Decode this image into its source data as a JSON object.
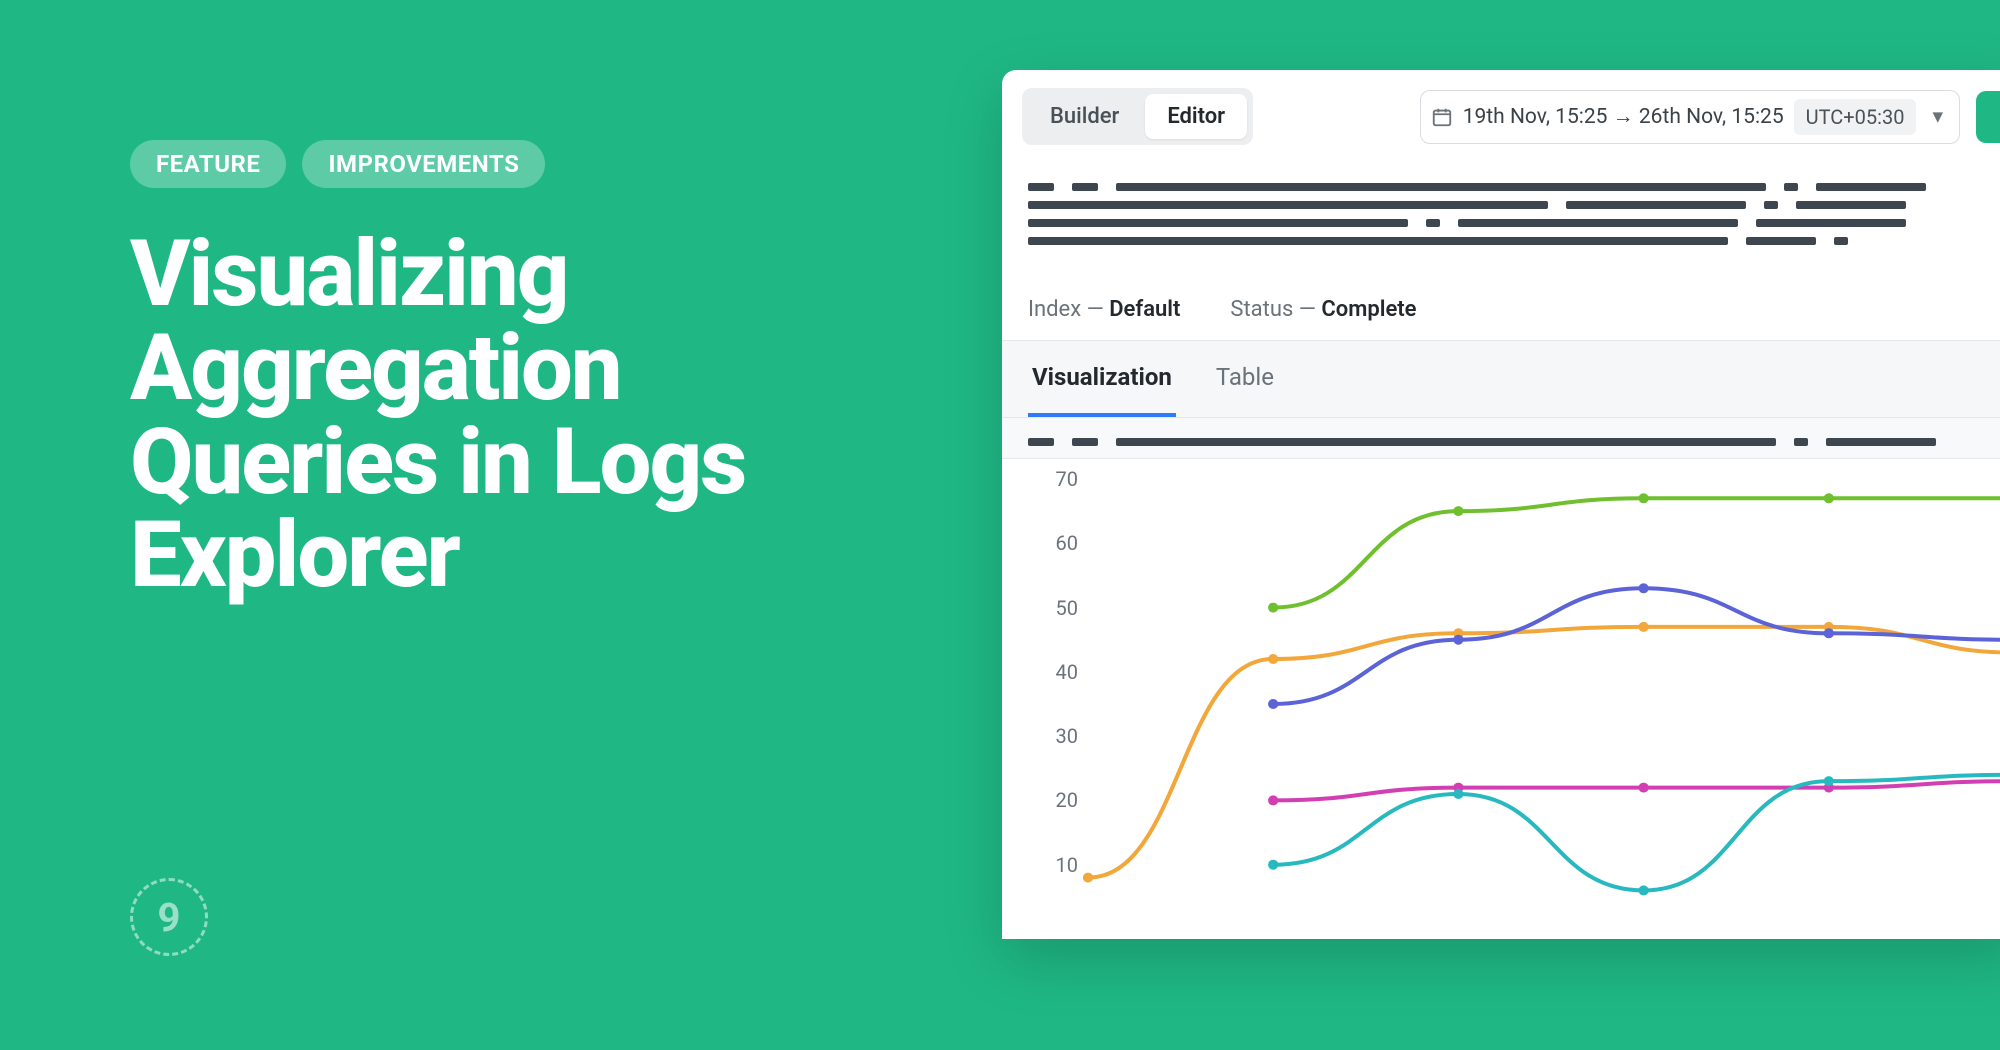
{
  "promo": {
    "badge_feature": "FEATURE",
    "badge_improvements": "IMPROVEMENTS",
    "headline": "Visualizing Aggregation Queries in Logs Explorer",
    "logo_char": "9"
  },
  "toolbar": {
    "builder_label": "Builder",
    "editor_label": "Editor",
    "date_range": "19th Nov, 15:25 → 26th Nov, 15:25",
    "timezone": "UTC+05:30"
  },
  "meta": {
    "index_label": "Index",
    "index_value": "Default",
    "status_label": "Status",
    "status_value": "Complete"
  },
  "tabs": {
    "visualization": "Visualization",
    "table": "Table"
  },
  "chart_data": {
    "type": "line",
    "ylim": [
      0,
      70
    ],
    "y_ticks": [
      10,
      20,
      30,
      40,
      50,
      60,
      70
    ],
    "x": [
      0,
      1,
      2,
      3,
      4,
      5
    ],
    "series": [
      {
        "name": "green",
        "color": "#6fbf2e",
        "values": [
          null,
          50,
          65,
          67,
          67,
          67
        ]
      },
      {
        "name": "orange",
        "color": "#f2a73b",
        "values": [
          8,
          42,
          46,
          47,
          47,
          43
        ]
      },
      {
        "name": "indigo",
        "color": "#5b63d6",
        "values": [
          null,
          35,
          45,
          53,
          46,
          45
        ]
      },
      {
        "name": "magenta",
        "color": "#d23fb3",
        "values": [
          null,
          20,
          22,
          22,
          22,
          23
        ]
      },
      {
        "name": "teal",
        "color": "#28b9c0",
        "values": [
          null,
          10,
          21,
          6,
          23,
          24
        ]
      }
    ]
  }
}
